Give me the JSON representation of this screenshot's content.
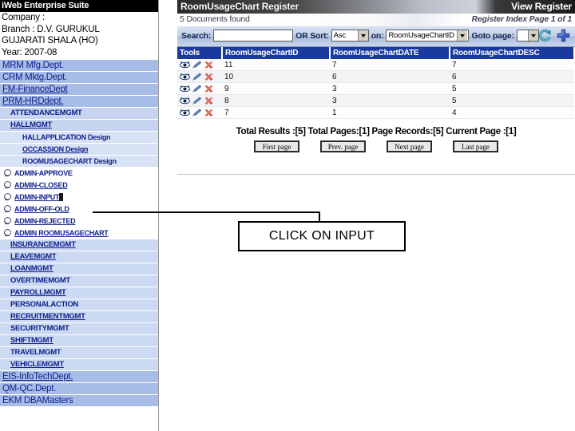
{
  "sidebar": {
    "app_title": "iWeb Enterprise Suite",
    "company_label": "Company :",
    "branch_label": "Branch : D.V. GURUKUL",
    "branch_label2": "GUJARATI SHALA (HO)",
    "year_label": "Year: 2007-08",
    "items": [
      {
        "label": "MRM Mfg.Dept.",
        "level": "lvl0",
        "underline": false,
        "icon": "none"
      },
      {
        "label": "CRM Mktg.Dept.",
        "level": "lvl0",
        "underline": false,
        "icon": "none"
      },
      {
        "label": "FM-FinanceDept",
        "level": "lvl0",
        "underline": true,
        "icon": "none"
      },
      {
        "label": "PRM-HRDdept.",
        "level": "lvl0",
        "underline": true,
        "icon": "none"
      },
      {
        "label": "ATTENDANCEMGMT",
        "level": "lvl1",
        "underline": false,
        "icon": "none"
      },
      {
        "label": "HALLMGMT",
        "level": "lvl1",
        "underline": true,
        "icon": "none"
      },
      {
        "label": "HALLAPPLICATION Design",
        "level": "lvl2",
        "underline": false,
        "icon": "none"
      },
      {
        "label": "OCCASSION Design",
        "level": "lvl2",
        "underline": true,
        "icon": "none"
      },
      {
        "label": "ROOMUSAGECHART Design",
        "level": "lvl2",
        "underline": false,
        "icon": "none"
      },
      {
        "label": "ADMIN-APPROVE",
        "level": "plain",
        "underline": false,
        "icon": "page-icon"
      },
      {
        "label": "ADMIN-CLOSED",
        "level": "plain",
        "underline": true,
        "icon": "page-icon"
      },
      {
        "label": "ADMIN-INPUT",
        "level": "plain",
        "underline": true,
        "icon": "page-icon",
        "highlight": true
      },
      {
        "label": "ADMIN-OFF-OLD",
        "level": "plain",
        "underline": true,
        "icon": "page-icon"
      },
      {
        "label": "ADMIN-REJECTED",
        "level": "plain",
        "underline": true,
        "icon": "page-icon"
      },
      {
        "label": "ADMIN ROOMUSAGECHART",
        "level": "plain",
        "underline": true,
        "icon": "page-icon"
      },
      {
        "label": "INSURANCEMGMT",
        "level": "lvl1b",
        "underline": true,
        "icon": "none"
      },
      {
        "label": "LEAVEMGMT",
        "level": "lvl1b",
        "underline": true,
        "icon": "none"
      },
      {
        "label": "LOANMGMT",
        "level": "lvl1b",
        "underline": true,
        "icon": "none"
      },
      {
        "label": "OVERTIMEMGMT",
        "level": "lvl1b",
        "underline": false,
        "icon": "none"
      },
      {
        "label": "PAYROLLMGMT",
        "level": "lvl1b",
        "underline": true,
        "icon": "none"
      },
      {
        "label": "PERSONALACTION",
        "level": "lvl1b",
        "underline": false,
        "icon": "none"
      },
      {
        "label": "RECRUITMENTMGMT",
        "level": "lvl1b",
        "underline": true,
        "icon": "none"
      },
      {
        "label": "SECURITYMGMT",
        "level": "lvl1b",
        "underline": false,
        "icon": "none"
      },
      {
        "label": "SHIFTMGMT",
        "level": "lvl1b",
        "underline": true,
        "icon": "none"
      },
      {
        "label": "TRAVELMGMT",
        "level": "lvl1b",
        "underline": false,
        "icon": "none"
      },
      {
        "label": "VEHICLEMGMT",
        "level": "lvl1b",
        "underline": true,
        "icon": "none"
      },
      {
        "label": "EIS-InfoTechDept.",
        "level": "lvl0",
        "underline": true,
        "icon": "none"
      },
      {
        "label": "QM-QC.Dept.",
        "level": "lvl0",
        "underline": false,
        "icon": "none"
      },
      {
        "label": "EKM DBAMasters",
        "level": "lvl0",
        "underline": false,
        "icon": "none"
      }
    ]
  },
  "main": {
    "title": "RoomUsageChart Register",
    "title_right": "View Register",
    "documents_found": "5 Documents found",
    "index_info": "Register Index Page 1 of 1",
    "toolbar": {
      "search_label": "Search:",
      "search_value": "",
      "sort_label": "OR Sort:",
      "sort_value": "Asc",
      "on_label": "on:",
      "on_value": "RoomUsageChartID",
      "goto_label": "Goto page:",
      "goto_value": "",
      "refresh_icon": "refresh-icon",
      "add_icon": "add-plus-icon"
    },
    "table": {
      "columns": [
        "Tools",
        "RoomUsageChartID",
        "RoomUsageChartDATE",
        "RoomUsageChartDESC"
      ],
      "row_icons": [
        "view-icon",
        "edit-pencil-icon",
        "delete-x-icon"
      ],
      "rows": [
        {
          "id": "11",
          "date": "7",
          "desc": "7"
        },
        {
          "id": "10",
          "date": "6",
          "desc": "6"
        },
        {
          "id": "9",
          "date": "3",
          "desc": "5"
        },
        {
          "id": "8",
          "date": "3",
          "desc": "5"
        },
        {
          "id": "7",
          "date": "1",
          "desc": "4"
        }
      ]
    },
    "summary": "Total Results :[5]  Total Pages:[1]  Page Records:[5]  Current Page :[1]",
    "pager": {
      "first": "First page",
      "prev": "Prev. page",
      "next": "Next page",
      "last": "Last page"
    }
  },
  "annotation": {
    "callout_text": "CLICK ON INPUT"
  },
  "colors": {
    "header_blue": "#1b3a9e",
    "menu_blue": "#a8bce8",
    "link_navy": "#10218b",
    "delete_red": "#d4554f"
  }
}
